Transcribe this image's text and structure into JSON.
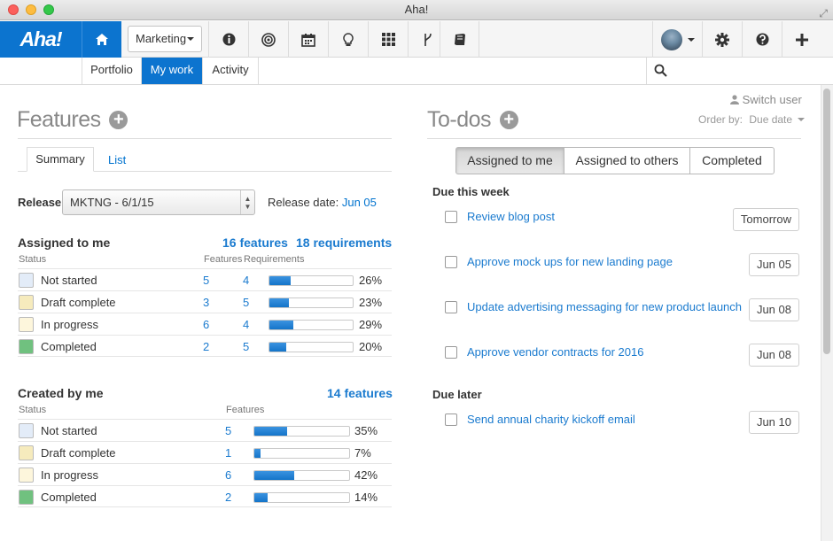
{
  "window": {
    "title": "Aha!"
  },
  "topnav": {
    "logo": "Aha!",
    "workspace": "Marketing",
    "icons": [
      "home-icon",
      "info-icon",
      "target-icon",
      "calendar-icon",
      "lightbulb-icon",
      "grid-icon",
      "branch-icon",
      "book-icon"
    ],
    "right_icons": [
      "avatar",
      "gear-icon",
      "help-icon",
      "plus-icon"
    ]
  },
  "subnav": {
    "tabs": [
      {
        "label": "Portfolio"
      },
      {
        "label": "My work"
      },
      {
        "label": "Activity"
      }
    ]
  },
  "features": {
    "title": "Features",
    "tabs": [
      {
        "label": "Summary"
      },
      {
        "label": "List"
      }
    ],
    "release_label": "Release",
    "release_value": "MKTNG - 6/1/15",
    "release_date_label": "Release date:",
    "release_date_value": "Jun 05",
    "assigned": {
      "title": "Assigned to me",
      "features_total": "16 features",
      "requirements_total": "18 requirements",
      "col_status": "Status",
      "col_features": "Features",
      "col_requirements": "Requirements",
      "rows": [
        {
          "status": "Not started",
          "features": "5",
          "requirements": "4",
          "pct": "26%",
          "frac": 0.26,
          "color": "#e3ecf8"
        },
        {
          "status": "Draft complete",
          "features": "3",
          "requirements": "5",
          "pct": "23%",
          "frac": 0.23,
          "color": "#f6ebbd"
        },
        {
          "status": "In progress",
          "features": "6",
          "requirements": "4",
          "pct": "29%",
          "frac": 0.29,
          "color": "#fdf6dc"
        },
        {
          "status": "Completed",
          "features": "2",
          "requirements": "5",
          "pct": "20%",
          "frac": 0.2,
          "color": "#70c17f"
        }
      ]
    },
    "created": {
      "title": "Created by me",
      "features_total": "14 features",
      "col_status": "Status",
      "col_features": "Features",
      "rows": [
        {
          "status": "Not started",
          "features": "5",
          "pct": "35%",
          "frac": 0.35,
          "color": "#e3ecf8"
        },
        {
          "status": "Draft complete",
          "features": "1",
          "pct": "7%",
          "frac": 0.07,
          "color": "#f6ebbd"
        },
        {
          "status": "In progress",
          "features": "6",
          "pct": "42%",
          "frac": 0.42,
          "color": "#fdf6dc"
        },
        {
          "status": "Completed",
          "features": "2",
          "pct": "14%",
          "frac": 0.14,
          "color": "#70c17f"
        }
      ]
    }
  },
  "todos": {
    "title": "To-dos",
    "switch_user": "Switch user",
    "order_by_label": "Order by:",
    "order_by_value": "Due date",
    "filters": [
      {
        "label": "Assigned to me"
      },
      {
        "label": "Assigned to others"
      },
      {
        "label": "Completed"
      }
    ],
    "groups": [
      {
        "label": "Due this week",
        "items": [
          {
            "text": "Review blog post",
            "due": "Tomorrow"
          },
          {
            "text": "Approve mock ups for new landing page",
            "due": "Jun 05"
          },
          {
            "text": "Update advertising messaging for new product launch",
            "due": "Jun 08"
          },
          {
            "text": "Approve vendor contracts for 2016",
            "due": "Jun 08"
          }
        ]
      },
      {
        "label": "Due later",
        "items": [
          {
            "text": "Send annual charity kickoff email",
            "due": "Jun 10"
          }
        ]
      }
    ]
  }
}
